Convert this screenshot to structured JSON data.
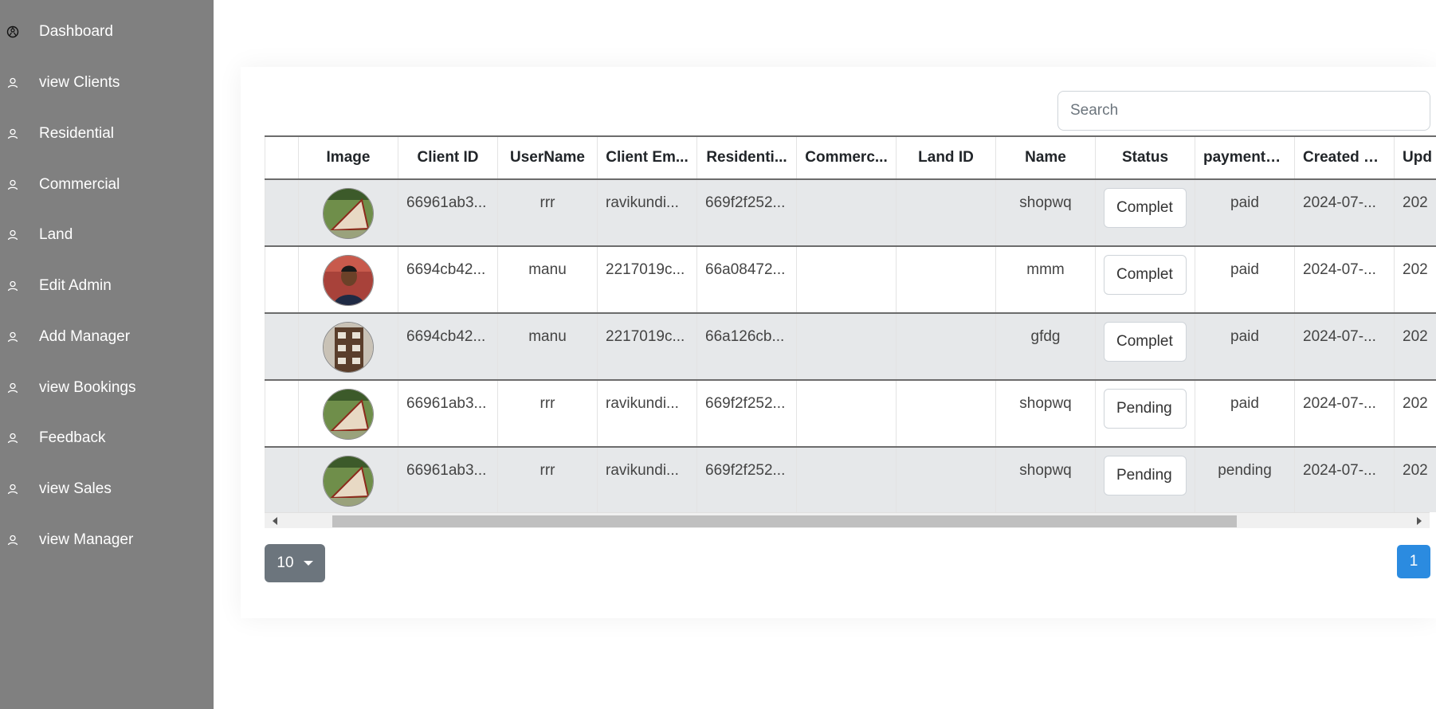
{
  "sidebar": {
    "items": [
      {
        "label": "Dashboard",
        "icon": "dashboard-icon"
      },
      {
        "label": "view Clients",
        "icon": "user-icon"
      },
      {
        "label": "Residential",
        "icon": "user-icon"
      },
      {
        "label": "Commercial",
        "icon": "user-icon"
      },
      {
        "label": "Land",
        "icon": "user-icon"
      },
      {
        "label": "Edit Admin",
        "icon": "user-icon"
      },
      {
        "label": "Add Manager",
        "icon": "user-icon"
      },
      {
        "label": "view Bookings",
        "icon": "user-icon"
      },
      {
        "label": "Feedback",
        "icon": "user-icon"
      },
      {
        "label": "view Sales",
        "icon": "user-icon"
      },
      {
        "label": "view Manager",
        "icon": "user-icon"
      }
    ]
  },
  "search": {
    "placeholder": "Search",
    "value": ""
  },
  "table": {
    "headers": [
      "",
      "Image",
      "Client ID",
      "UserName",
      "Client Em...",
      "Residenti...",
      "Commerc...",
      "Land ID",
      "Name",
      "Status",
      "payment_...",
      "Created D...",
      "Upd"
    ],
    "rows": [
      {
        "image": "plot-photo",
        "client_id": "66961ab3...",
        "username": "rrr",
        "client_email": "ravikundi...",
        "residential": "669f2f252...",
        "commercial": "",
        "land_id": "",
        "name": "shopwq",
        "status": "Complet",
        "payment": "paid",
        "created": "2024-07-...",
        "updated": "202"
      },
      {
        "image": "person-photo",
        "client_id": "6694cb42...",
        "username": "manu",
        "client_email": "2217019c...",
        "residential": "66a08472...",
        "commercial": "",
        "land_id": "",
        "name": "mmm",
        "status": "Complet",
        "payment": "paid",
        "created": "2024-07-...",
        "updated": "202"
      },
      {
        "image": "building-photo",
        "client_id": "6694cb42...",
        "username": "manu",
        "client_email": "2217019c...",
        "residential": "66a126cb...",
        "commercial": "",
        "land_id": "",
        "name": "gfdg",
        "status": "Complet",
        "payment": "paid",
        "created": "2024-07-...",
        "updated": "202"
      },
      {
        "image": "plot-photo",
        "client_id": "66961ab3...",
        "username": "rrr",
        "client_email": "ravikundi...",
        "residential": "669f2f252...",
        "commercial": "",
        "land_id": "",
        "name": "shopwq",
        "status": "Pending",
        "payment": "paid",
        "created": "2024-07-...",
        "updated": "202"
      },
      {
        "image": "plot-photo",
        "client_id": "66961ab3...",
        "username": "rrr",
        "client_email": "ravikundi...",
        "residential": "669f2f252...",
        "commercial": "",
        "land_id": "",
        "name": "shopwq",
        "status": "Pending",
        "payment": "pending",
        "created": "2024-07-...",
        "updated": "202"
      }
    ]
  },
  "pagination": {
    "page_size": "10",
    "current_page": "1"
  }
}
